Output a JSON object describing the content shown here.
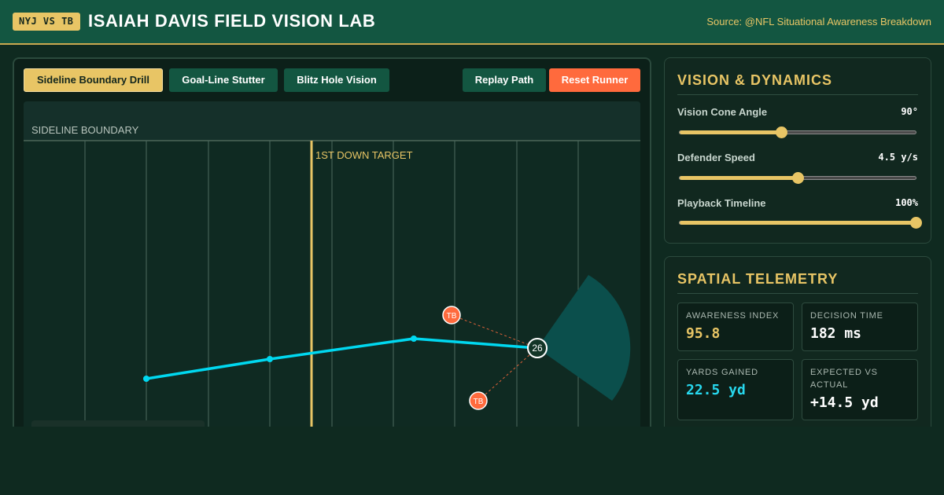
{
  "header": {
    "badge": "NYJ VS TB",
    "title": "ISAIAH DAVIS FIELD VISION LAB",
    "source": "Source: @NFL Situational Awareness Breakdown"
  },
  "drills": [
    {
      "label": "Sideline Boundary Drill",
      "active": true
    },
    {
      "label": "Goal-Line Stutter",
      "active": false
    },
    {
      "label": "Blitz Hole Vision",
      "active": false
    }
  ],
  "actions": {
    "replay": "Replay Path",
    "reset": "Reset Runner"
  },
  "field": {
    "sideline_label": "SIDELINE BOUNDARY",
    "first_down_label": "1ST DOWN TARGET",
    "runner_number": "26",
    "defender_label": "TB",
    "colors": {
      "path": "#00d8f0",
      "first_down": "#e8c565",
      "defender": "#ff6a3d",
      "cone": "#0b4f4c"
    }
  },
  "vision": {
    "title": "VISION & DYNAMICS",
    "controls": [
      {
        "label": "Vision Cone Angle",
        "value": "90°",
        "level": 0.43
      },
      {
        "label": "Defender Speed",
        "value": "4.5 y/s",
        "level": 0.5
      },
      {
        "label": "Playback Timeline",
        "value": "100%",
        "level": 1.0
      }
    ]
  },
  "telemetry": {
    "title": "SPATIAL TELEMETRY",
    "cards": [
      {
        "label": "AWARENESS INDEX",
        "value": "95.8",
        "color": "#e8c565"
      },
      {
        "label": "DECISION TIME",
        "value": "182 ms",
        "color": "#ffffff"
      },
      {
        "label": "YARDS GAINED",
        "value": "22.5 yd",
        "color": "#27d8ee"
      },
      {
        "label": "EXPECTED VS ACTUAL",
        "value": "+14.5 yd",
        "color": "#ffffff"
      }
    ]
  }
}
